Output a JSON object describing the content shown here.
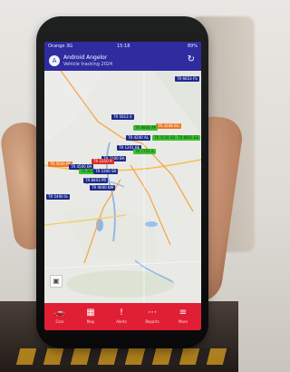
{
  "status_bar": {
    "carrier": "Orange  3G",
    "time": "15:18",
    "battery": "89%"
  },
  "app_header": {
    "title": "Android Angelor",
    "subtitle": "Vehicle tracking 2024",
    "logo_symbol": "A",
    "refresh_symbol": "↻"
  },
  "map": {
    "layers_symbol": "▣",
    "markers": [
      {
        "label": "TR 6653 FS",
        "color": "blue"
      },
      {
        "label": "TR 5013 4",
        "color": "blue"
      },
      {
        "label": "TR 3208 EG",
        "color": "orange"
      },
      {
        "label": "TR 8808 AP",
        "color": "green"
      },
      {
        "label": "TR 4200 AL",
        "color": "blue"
      },
      {
        "label": "TR 5530 SR",
        "color": "green"
      },
      {
        "label": "TR 8801 EE",
        "color": "green"
      },
      {
        "label": "TR 1201 BE",
        "color": "blue"
      },
      {
        "label": "TR 7751 IL",
        "color": "green"
      },
      {
        "label": "TR 2200 BA",
        "color": "blue"
      },
      {
        "label": "TR 2310 A",
        "color": "red"
      },
      {
        "label": "TR 5500 PR",
        "color": "orange"
      },
      {
        "label": "TR 4500 BA",
        "color": "blue"
      },
      {
        "label": "TR 3000 S2",
        "color": "green"
      },
      {
        "label": "TR 5300 SR",
        "color": "blue"
      },
      {
        "label": "TR 8403 PR",
        "color": "blue"
      },
      {
        "label": "TR 5400 IS",
        "color": "blue"
      },
      {
        "label": "TR 9000 BM",
        "color": "blue"
      }
    ]
  },
  "bottom_nav": {
    "items": [
      {
        "label": "Cars",
        "icon": "🚗"
      },
      {
        "label": "Map",
        "icon": "▦"
      },
      {
        "label": "Alerts",
        "icon": "!"
      },
      {
        "label": "Reports",
        "icon": "⋯"
      },
      {
        "label": "More",
        "icon": "≡"
      }
    ]
  }
}
